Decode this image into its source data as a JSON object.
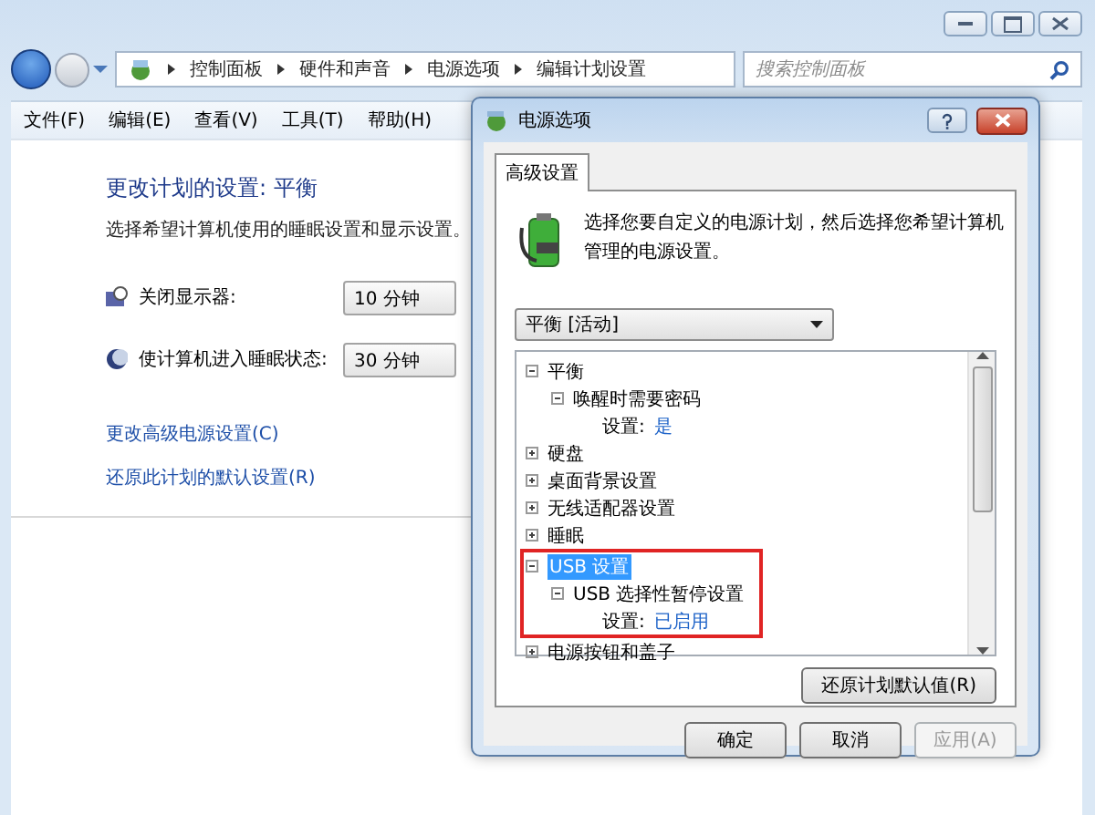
{
  "address_bar": {
    "crumbs": [
      "控制面板",
      "硬件和声音",
      "电源选项",
      "编辑计划设置"
    ]
  },
  "search": {
    "placeholder": "搜索控制面板"
  },
  "menu": [
    "文件(F)",
    "编辑(E)",
    "查看(V)",
    "工具(T)",
    "帮助(H)"
  ],
  "page": {
    "title": "更改计划的设置: 平衡",
    "subtitle": "选择希望计算机使用的睡眠设置和显示设置。",
    "settings": [
      {
        "kind": "display",
        "label": "关闭显示器:",
        "value": "10 分钟"
      },
      {
        "kind": "sleep",
        "label": "使计算机进入睡眠状态:",
        "value": "30 分钟"
      }
    ],
    "links": [
      "更改高级电源设置(C)",
      "还原此计划的默认设置(R)"
    ]
  },
  "dialog": {
    "title": "电源选项",
    "tabs": [
      {
        "label": "高级设置",
        "selected": true
      }
    ],
    "intro": "选择您要自定义的电源计划，然后选择您希望计算机管理的电源设置。",
    "plan": "平衡 [活动]",
    "tree": [
      {
        "label": "平衡",
        "expanded": true,
        "selected": false,
        "highlighted": false,
        "children": [
          {
            "label": "唤醒时需要密码",
            "expanded": true,
            "selected": false,
            "highlighted": false,
            "children": [
              {
                "kind": "setting",
                "label": "设置:",
                "value": "是"
              }
            ]
          }
        ]
      },
      {
        "label": "硬盘",
        "expanded": false,
        "selected": false,
        "highlighted": false
      },
      {
        "label": "桌面背景设置",
        "expanded": false,
        "selected": false,
        "highlighted": false
      },
      {
        "label": "无线适配器设置",
        "expanded": false,
        "selected": false,
        "highlighted": false
      },
      {
        "label": "睡眠",
        "expanded": false,
        "selected": false,
        "highlighted": false
      },
      {
        "label": "USB 设置",
        "expanded": true,
        "selected": true,
        "highlighted": true,
        "children": [
          {
            "label": "USB 选择性暂停设置",
            "expanded": true,
            "selected": false,
            "highlighted": false,
            "children": [
              {
                "kind": "setting",
                "label": "设置:",
                "value": "已启用"
              }
            ]
          }
        ]
      },
      {
        "label": "电源按钮和盖子",
        "expanded": false,
        "selected": false,
        "highlighted": false
      }
    ],
    "restore_button": "还原计划默认值(R)",
    "buttons": [
      {
        "label": "确定",
        "disabled": false
      },
      {
        "label": "取消",
        "disabled": false
      },
      {
        "label": "应用(A)",
        "disabled": true
      }
    ]
  }
}
